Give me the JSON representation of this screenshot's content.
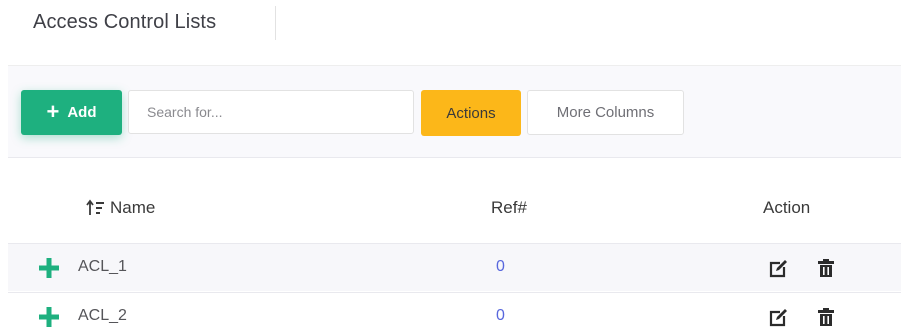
{
  "header": {
    "title": "Access Control Lists"
  },
  "toolbar": {
    "add_label": "Add",
    "search_placeholder": "Search for...",
    "actions_label": "Actions",
    "more_columns_label": "More Columns"
  },
  "table": {
    "columns": [
      "Name",
      "Ref#",
      "Action"
    ],
    "rows": [
      {
        "name": "ACL_1",
        "ref": "0"
      },
      {
        "name": "ACL_2",
        "ref": "0"
      }
    ]
  },
  "colors": {
    "add": "#1eb07f",
    "actions": "#fcb719",
    "ref_link": "#5867dd"
  },
  "icons": [
    "plus-icon",
    "sort-icon",
    "expand-plus-icon",
    "edit-icon",
    "trash-icon"
  ]
}
